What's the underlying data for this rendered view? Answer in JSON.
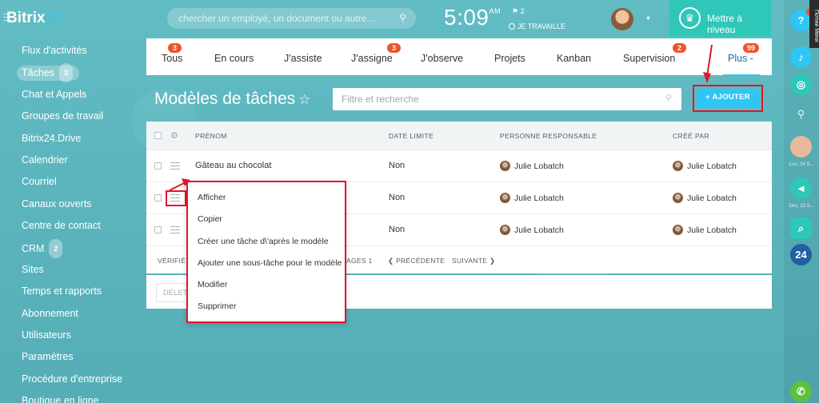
{
  "header": {
    "logo_main": "Bitrix",
    "logo_num": "24",
    "search_placeholder": "chercher un employé, un document ou autre...",
    "time": "5:09",
    "ampm": "AM",
    "flag_count": "2",
    "work_status": "JE TRAVAILLE",
    "upgrade_label": "Mettre à niveau"
  },
  "sidebar": {
    "items": [
      {
        "label": "Flux d'activités"
      },
      {
        "label": "Tâches",
        "counter": "3"
      },
      {
        "label": "Chat et Appels"
      },
      {
        "label": "Groupes de travail"
      },
      {
        "label": "Bitrix24.Drive"
      },
      {
        "label": "Calendrier"
      },
      {
        "label": "Courriel"
      },
      {
        "label": "Canaux ouverts"
      },
      {
        "label": "Centre de contact"
      },
      {
        "label": "CRM",
        "counter": "2"
      },
      {
        "label": "Sites"
      },
      {
        "label": "Temps et rapports"
      },
      {
        "label": "Abonnement"
      },
      {
        "label": "Utilisateurs"
      },
      {
        "label": "Paramètres"
      },
      {
        "label": "Procédure d'entreprise"
      },
      {
        "label": "Boutique en ligne"
      }
    ]
  },
  "tabs": [
    {
      "label": "Tous",
      "badge": "3"
    },
    {
      "label": "En cours"
    },
    {
      "label": "J'assiste"
    },
    {
      "label": "J'assigne",
      "badge": "3"
    },
    {
      "label": "J'observe"
    },
    {
      "label": "Projets"
    },
    {
      "label": "Kanban"
    },
    {
      "label": "Supervision",
      "badge": "2"
    },
    {
      "label": "Plus -",
      "badge": "99"
    }
  ],
  "page": {
    "title": "Modèles de tâches",
    "star": "☆",
    "filter_placeholder": "Filtre et recherche",
    "add_button": "+ AJOUTER"
  },
  "grid": {
    "columns": [
      "PRÉNOM",
      "DATE LIMITE",
      "PERSONNE RESPONSABLE",
      "CRÉÉ PAR"
    ],
    "rows": [
      {
        "name": "Gâteau au chocolat",
        "deadline": "Non",
        "responsible": "Julie Lobatch",
        "created_by": "Julie Lobatch"
      },
      {
        "name": "",
        "deadline": "Non",
        "responsible": "Julie Lobatch",
        "created_by": "Julie Lobatch"
      },
      {
        "name": "",
        "deadline": "Non",
        "responsible": "Julie Lobatch",
        "created_by": "Julie Lobatch"
      }
    ],
    "footer": {
      "verified": "VÉRIFIÉ :",
      "pages": "AGES  1",
      "prev": "❮ PRÉCÉDENTE",
      "next": "SUIVANTE ❯"
    },
    "delete_label": "DELET"
  },
  "context_menu": {
    "items": [
      "Afficher",
      "Copier",
      "Créer une tâche d\\'après le modèle",
      "Ajouter une sous-tâche pour le modèle",
      "Modifier",
      "Supprimer"
    ]
  },
  "rightbar": {
    "date1": "Lun, 24 S...",
    "date2": "Dim, 23 S...",
    "badge24": "24",
    "vertical_tab": "Потiни Меня"
  },
  "colors": {
    "accent": "#2fc6f6",
    "highlight": "#e0162b",
    "badge": "#f0532c",
    "upgrade": "#2fc7b8"
  }
}
